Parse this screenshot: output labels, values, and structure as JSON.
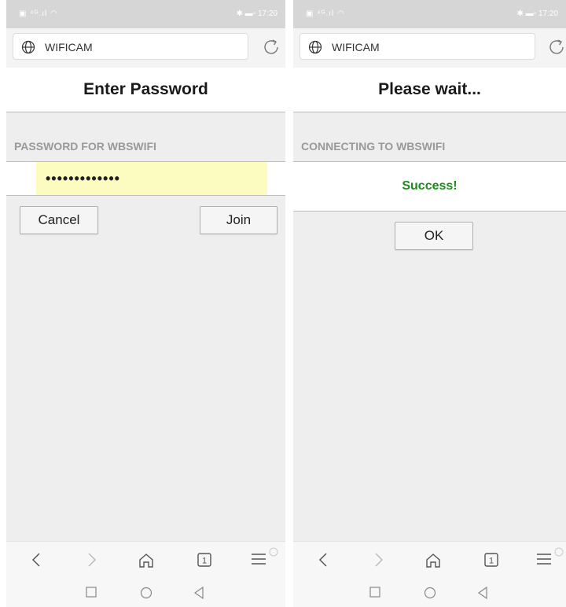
{
  "left_screen": {
    "status_time": "17:20",
    "url": "WIFICAM",
    "title": "Enter Password",
    "section_label": "PASSWORD FOR WBSWIFI",
    "password_value": "•••••••••••••",
    "cancel_label": "Cancel",
    "join_label": "Join"
  },
  "right_screen": {
    "status_time": "17:20",
    "url": "WIFICAM",
    "title": "Please wait...",
    "section_label": "CONNECTING TO WBSWIFI",
    "status_message": "Success!",
    "ok_label": "OK"
  },
  "browser_nav": {
    "tab_count": "1"
  },
  "icons": [
    "globe-icon",
    "reload-icon",
    "back-icon",
    "forward-icon",
    "home-icon",
    "tabs-icon",
    "menu-icon",
    "recents-icon",
    "home-circle-icon",
    "back-triangle-icon"
  ],
  "colors": {
    "success_text": "#1d8a1d",
    "password_bg": "#fcfcc0",
    "page_bg": "#eeeeee",
    "section_label": "#999999"
  }
}
